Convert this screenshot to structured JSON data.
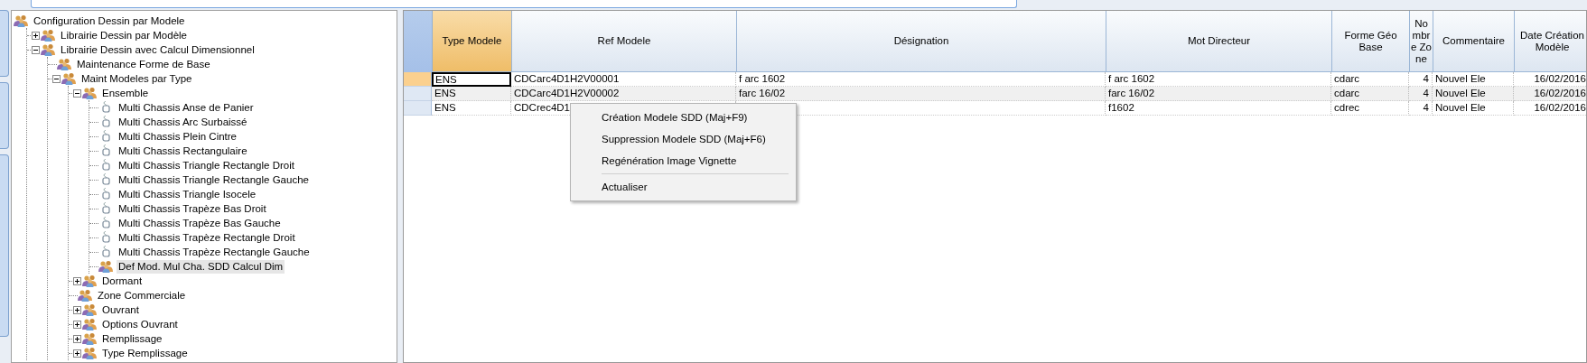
{
  "tree": [
    {
      "label": "Configuration Dessin par Modele",
      "kind": "group",
      "selected": false,
      "children": [
        {
          "label": "Librairie Dessin par Modèle",
          "kind": "group",
          "selected": false,
          "expanded": false
        },
        {
          "label": "Librairie Dessin avec Calcul Dimensionnel",
          "kind": "group",
          "selected": false,
          "expanded": true,
          "children": [
            {
              "label": "Maintenance Forme de Base",
              "kind": "group",
              "selected": false
            },
            {
              "label": "Maint Modeles par Type",
              "kind": "group",
              "selected": false,
              "expanded": true,
              "children": [
                {
                  "label": "Ensemble",
                  "kind": "group",
                  "selected": false,
                  "expanded": true,
                  "children": [
                    {
                      "label": "Multi Chassis Anse de Panier",
                      "kind": "model",
                      "selected": false
                    },
                    {
                      "label": "Multi Chassis Arc Surbaissé",
                      "kind": "model",
                      "selected": false
                    },
                    {
                      "label": "Multi Chassis Plein Cintre",
                      "kind": "model",
                      "selected": false
                    },
                    {
                      "label": "Multi Chassis Rectangulaire",
                      "kind": "model",
                      "selected": false
                    },
                    {
                      "label": "Multi Chassis Triangle Rectangle Droit",
                      "kind": "model",
                      "selected": false
                    },
                    {
                      "label": "Multi Chassis Triangle Rectangle  Gauche",
                      "kind": "model",
                      "selected": false
                    },
                    {
                      "label": "Multi Chassis Triangle Isocele",
                      "kind": "model",
                      "selected": false
                    },
                    {
                      "label": "Multi Chassis Trapèze Bas Droit",
                      "kind": "model",
                      "selected": false
                    },
                    {
                      "label": "Multi Chassis Trapèze Bas Gauche",
                      "kind": "model",
                      "selected": false
                    },
                    {
                      "label": "Multi Chassis Trapèze Rectangle Droit",
                      "kind": "model",
                      "selected": false
                    },
                    {
                      "label": "Multi Chassis Trapèze Rectangle Gauche",
                      "kind": "model",
                      "selected": false
                    },
                    {
                      "label": "Def Mod. Mul Cha. SDD Calcul Dim",
                      "kind": "group",
                      "selected": true
                    }
                  ]
                },
                {
                  "label": "Dormant",
                  "kind": "group",
                  "selected": false,
                  "expanded": false
                },
                {
                  "label": "Zone Commerciale",
                  "kind": "group",
                  "selected": false
                },
                {
                  "label": "Ouvrant",
                  "kind": "group",
                  "selected": false,
                  "expanded": false
                },
                {
                  "label": "Options Ouvrant",
                  "kind": "group",
                  "selected": false,
                  "expanded": false
                },
                {
                  "label": "Remplissage",
                  "kind": "group",
                  "selected": false,
                  "expanded": false
                },
                {
                  "label": "Type Remplissage",
                  "kind": "group",
                  "selected": false,
                  "expanded": false
                }
              ]
            }
          ]
        }
      ]
    }
  ],
  "table": {
    "columns": [
      {
        "label": "Type Modele",
        "selected": true,
        "kind": "text"
      },
      {
        "label": "Ref Modele",
        "selected": false,
        "kind": "text"
      },
      {
        "label": "Désignation",
        "selected": false,
        "kind": "text"
      },
      {
        "label": "Mot Directeur",
        "selected": false,
        "kind": "text"
      },
      {
        "label": "Forme Géo Base",
        "selected": false,
        "kind": "text"
      },
      {
        "label": "Nombre Zone",
        "selected": false,
        "kind": "number"
      },
      {
        "label": "Commentaire",
        "selected": false,
        "kind": "text"
      },
      {
        "label": "Date Création Modèle",
        "selected": false,
        "kind": "number"
      }
    ],
    "rows": [
      {
        "selected": true,
        "cells": [
          "ENS",
          "CDCarc4D1H2V00001",
          "f arc 1602",
          "f arc 1602",
          "cdarc",
          "4",
          "Nouvel Ele",
          "16/02/2016"
        ]
      },
      {
        "selected": false,
        "cells": [
          "ENS",
          "CDCarc4D1H2V00002",
          "farc 16/02",
          "farc 16/02",
          "cdarc",
          "4",
          "Nouvel Ele",
          "16/02/2016"
        ]
      },
      {
        "selected": false,
        "cells": [
          "ENS",
          "CDCrec4D1",
          null,
          "f1602",
          "cdrec",
          "4",
          "Nouvel Ele",
          "16/02/2016"
        ]
      }
    ]
  },
  "context_menu": [
    {
      "label": "Création Modele SDD (Maj+F9)",
      "separator_before": false
    },
    {
      "label": "Suppression Modele SDD (Maj+F6)",
      "separator_before": false
    },
    {
      "label": "Regénération Image Vignette",
      "separator_before": false
    },
    {
      "label": "Actualiser",
      "separator_before": true
    }
  ]
}
